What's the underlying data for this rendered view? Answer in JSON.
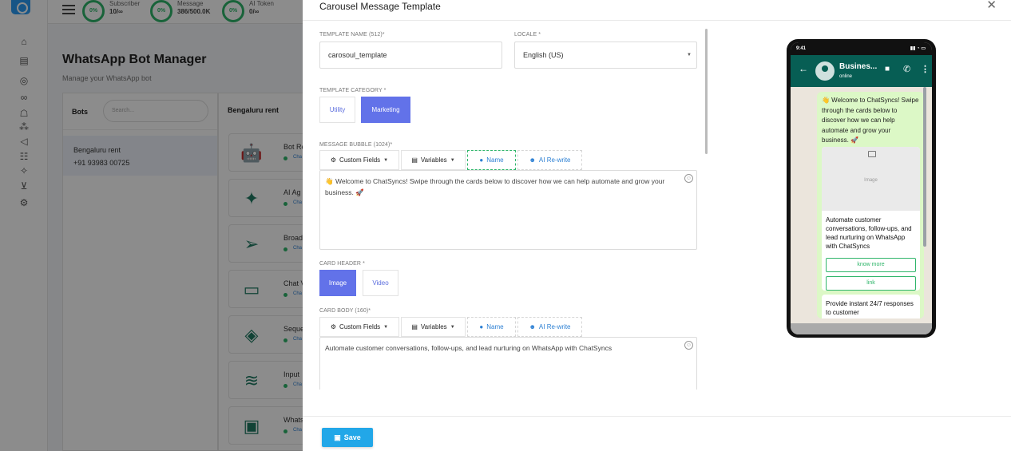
{
  "backdrop": {
    "stats": [
      {
        "ring": "0%",
        "label": "Subscriber",
        "value": "10/∞"
      },
      {
        "ring": "0%",
        "label": "Message",
        "value": "386/500.0K"
      },
      {
        "ring": "0%",
        "label": "AI Token",
        "value": "0/∞"
      }
    ],
    "page_title": "WhatsApp Bot Manager",
    "page_subtitle": "Manage your WhatsApp bot",
    "bots_header": "Bots",
    "bots_search_placeholder": "Search...",
    "bot": {
      "name": "Bengaluru rent",
      "phone": "+91 93983 00725"
    },
    "flows_header": "Bengaluru rent",
    "flows": [
      {
        "label": "Bot Re",
        "icon": "robot-icon",
        "channel": "Cha"
      },
      {
        "label": "AI Ag",
        "icon": "magic-wand-icon",
        "channel": "Cha"
      },
      {
        "label": "Broad",
        "icon": "paper-plane-icon",
        "channel": "Cha"
      },
      {
        "label": "Chat V",
        "icon": "chat-bubble-icon",
        "channel": "Cha"
      },
      {
        "label": "Seque",
        "icon": "paint-bucket-icon",
        "channel": "Cha"
      },
      {
        "label": "Input",
        "icon": "stack-icon",
        "channel": "Cha"
      },
      {
        "label": "Whats",
        "icon": "frame-icon",
        "channel": "Cha"
      }
    ]
  },
  "modal": {
    "title": "Carousel Message Template",
    "template_name_label": "TEMPLATE NAME (512)*",
    "template_name_value": "carosoul_template",
    "locale_label": "LOCALE *",
    "locale_value": "English (US)",
    "category_label": "TEMPLATE CATEGORY *",
    "category_options": [
      "Utility",
      "Marketing"
    ],
    "category_selected": "Marketing",
    "bubble_label": "MESSAGE BUBBLE (1024)*",
    "toolbar": {
      "custom_fields": "Custom Fields",
      "variables": "Variables",
      "name": "Name",
      "ai_rewrite": "AI Re-write"
    },
    "bubble_text": "👋 Welcome to ChatSyncs! Swipe through the cards below to discover how we can help automate and grow your business. 🚀",
    "card_header_label": "CARD HEADER *",
    "card_header_options": [
      "Image",
      "Video"
    ],
    "card_header_selected": "Image",
    "card_body_label": "CARD BODY (160)*",
    "card_body_text": "Automate customer conversations, follow-ups, and lead nurturing on WhatsApp with ChatSyncs",
    "save_label": "Save"
  },
  "preview": {
    "time": "9:41",
    "contact_name": "Busines...",
    "contact_status": "online",
    "bubble_text": "👋 Welcome to ChatSyncs! Swipe through the cards below to discover how we can help automate and grow your business. 🚀",
    "image_placeholder": "Image",
    "card1_text": "Automate customer conversations, follow-ups, and lead nurturing on WhatsApp with ChatSyncs",
    "card1_buttons": [
      "know more",
      "link"
    ],
    "card2_text": "Provide instant 24/7 responses to customer"
  },
  "colors": {
    "primary": "#6272e9",
    "save": "#22a7e8",
    "whatsapp_header": "#075e54",
    "bubble": "#dcf8c6",
    "green": "#2fb56a"
  }
}
